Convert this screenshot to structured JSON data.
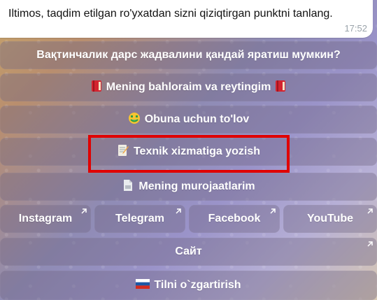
{
  "message": {
    "text": "Iltimos, taqdim etilgan ro'yxatdan sizni qiziqtirgan punktni tanlang.",
    "time": "17:52"
  },
  "keyboard": {
    "row1": {
      "label": "Вақтинчалик дарс жадвалини қандай яратиш мумкин?"
    },
    "row2": {
      "label": "Mening bahloraim va reytingim",
      "icon_left": "book-red-icon",
      "icon_right": "book-red-icon"
    },
    "row3": {
      "label": "Obuna uchun to'lov",
      "icon": "money-mouth-face-icon"
    },
    "row4": {
      "label": "Texnik xizmatiga yozish",
      "icon": "memo-icon"
    },
    "row5": {
      "label": "Mening murojaatlarim",
      "icon": "document-icon"
    },
    "socials": [
      {
        "label": "Instagram"
      },
      {
        "label": "Telegram"
      },
      {
        "label": "Facebook"
      },
      {
        "label": "YouTube"
      }
    ],
    "site": {
      "label": "Сайт"
    },
    "language": {
      "label": "Tilni o`zgartirish",
      "icon": "russia-flag-icon"
    }
  },
  "colors": {
    "highlight": "#e00000",
    "button_bg": "rgba(110,100,130,.38)"
  }
}
